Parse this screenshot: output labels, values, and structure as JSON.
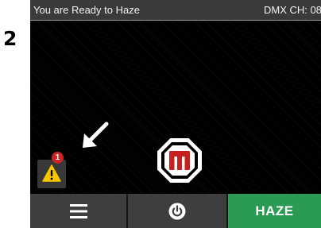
{
  "step": {
    "number": "2"
  },
  "status_bar": {
    "title": "You are Ready to Haze",
    "dmx_channel": "DMX CH: 08"
  },
  "warning": {
    "icon": "warning-triangle-icon",
    "badge_count": "1",
    "pointer_icon": "arrow-pointer-icon"
  },
  "center_logo": {
    "icon": "m-logo-icon"
  },
  "bottom_bar": {
    "menu_icon": "hamburger-menu-icon",
    "power_icon": "power-icon",
    "haze_label": "HAZE"
  },
  "colors": {
    "status_bar_bg": "#3a3a3a",
    "screen_bg": "#000000",
    "warning_yellow": "#f7c600",
    "badge_red": "#cc2424",
    "logo_red": "#c8201e",
    "haze_green": "#2b9b54",
    "button_gray": "#3e3e3e"
  }
}
